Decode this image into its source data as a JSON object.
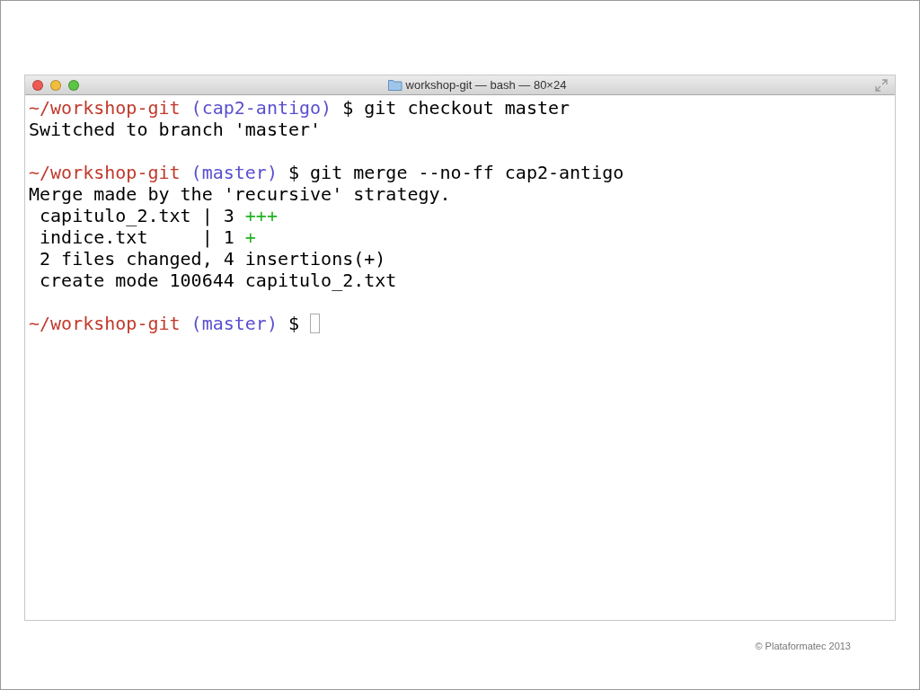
{
  "window": {
    "title": "workshop-git — bash — 80×24"
  },
  "terminal": {
    "lines": [
      {
        "kind": "text",
        "segments": [
          {
            "kind": "path",
            "text": "~/workshop-git"
          },
          {
            "kind": "branch",
            "text": " (cap2-antigo)"
          },
          {
            "kind": "plain",
            "text": " $ git checkout master"
          }
        ]
      },
      {
        "kind": "text",
        "segments": [
          {
            "kind": "plain",
            "text": "Switched to branch 'master'"
          }
        ]
      },
      {
        "kind": "blank"
      },
      {
        "kind": "text",
        "segments": [
          {
            "kind": "path",
            "text": "~/workshop-git"
          },
          {
            "kind": "branch",
            "text": " (master)"
          },
          {
            "kind": "plain",
            "text": " $ git merge --no-ff cap2-antigo"
          }
        ]
      },
      {
        "kind": "text",
        "segments": [
          {
            "kind": "plain",
            "text": "Merge made by the 'recursive' strategy."
          }
        ]
      },
      {
        "kind": "text",
        "segments": [
          {
            "kind": "plain",
            "text": " capitulo_2.txt | 3 "
          },
          {
            "kind": "added",
            "text": "+++"
          }
        ]
      },
      {
        "kind": "text",
        "segments": [
          {
            "kind": "plain",
            "text": " indice.txt     | 1 "
          },
          {
            "kind": "added",
            "text": "+"
          }
        ]
      },
      {
        "kind": "text",
        "segments": [
          {
            "kind": "plain",
            "text": " 2 files changed, 4 insertions(+)"
          }
        ]
      },
      {
        "kind": "text",
        "segments": [
          {
            "kind": "plain",
            "text": " create mode 100644 capitulo_2.txt"
          }
        ]
      },
      {
        "kind": "blank"
      },
      {
        "kind": "text",
        "cursor": true,
        "segments": [
          {
            "kind": "path",
            "text": "~/workshop-git"
          },
          {
            "kind": "branch",
            "text": " (master)"
          },
          {
            "kind": "plain",
            "text": " $ "
          }
        ]
      }
    ]
  },
  "footer": {
    "copyright": "© Plataformatec 2013"
  }
}
